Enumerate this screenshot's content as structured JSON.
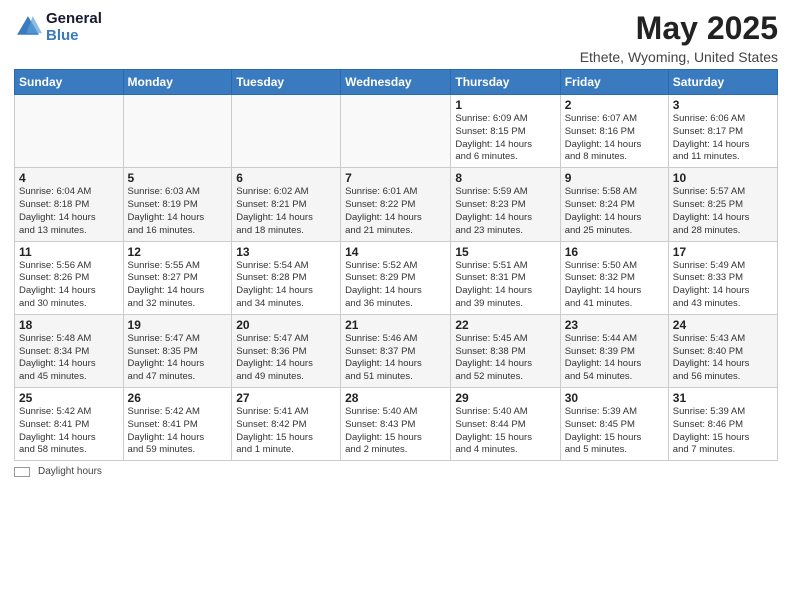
{
  "logo": {
    "line1": "General",
    "line2": "Blue"
  },
  "title": "May 2025",
  "location": "Ethete, Wyoming, United States",
  "days_of_week": [
    "Sunday",
    "Monday",
    "Tuesday",
    "Wednesday",
    "Thursday",
    "Friday",
    "Saturday"
  ],
  "footer_label": "Daylight hours",
  "weeks": [
    [
      {
        "num": "",
        "info": ""
      },
      {
        "num": "",
        "info": ""
      },
      {
        "num": "",
        "info": ""
      },
      {
        "num": "",
        "info": ""
      },
      {
        "num": "1",
        "info": "Sunrise: 6:09 AM\nSunset: 8:15 PM\nDaylight: 14 hours\nand 6 minutes."
      },
      {
        "num": "2",
        "info": "Sunrise: 6:07 AM\nSunset: 8:16 PM\nDaylight: 14 hours\nand 8 minutes."
      },
      {
        "num": "3",
        "info": "Sunrise: 6:06 AM\nSunset: 8:17 PM\nDaylight: 14 hours\nand 11 minutes."
      }
    ],
    [
      {
        "num": "4",
        "info": "Sunrise: 6:04 AM\nSunset: 8:18 PM\nDaylight: 14 hours\nand 13 minutes."
      },
      {
        "num": "5",
        "info": "Sunrise: 6:03 AM\nSunset: 8:19 PM\nDaylight: 14 hours\nand 16 minutes."
      },
      {
        "num": "6",
        "info": "Sunrise: 6:02 AM\nSunset: 8:21 PM\nDaylight: 14 hours\nand 18 minutes."
      },
      {
        "num": "7",
        "info": "Sunrise: 6:01 AM\nSunset: 8:22 PM\nDaylight: 14 hours\nand 21 minutes."
      },
      {
        "num": "8",
        "info": "Sunrise: 5:59 AM\nSunset: 8:23 PM\nDaylight: 14 hours\nand 23 minutes."
      },
      {
        "num": "9",
        "info": "Sunrise: 5:58 AM\nSunset: 8:24 PM\nDaylight: 14 hours\nand 25 minutes."
      },
      {
        "num": "10",
        "info": "Sunrise: 5:57 AM\nSunset: 8:25 PM\nDaylight: 14 hours\nand 28 minutes."
      }
    ],
    [
      {
        "num": "11",
        "info": "Sunrise: 5:56 AM\nSunset: 8:26 PM\nDaylight: 14 hours\nand 30 minutes."
      },
      {
        "num": "12",
        "info": "Sunrise: 5:55 AM\nSunset: 8:27 PM\nDaylight: 14 hours\nand 32 minutes."
      },
      {
        "num": "13",
        "info": "Sunrise: 5:54 AM\nSunset: 8:28 PM\nDaylight: 14 hours\nand 34 minutes."
      },
      {
        "num": "14",
        "info": "Sunrise: 5:52 AM\nSunset: 8:29 PM\nDaylight: 14 hours\nand 36 minutes."
      },
      {
        "num": "15",
        "info": "Sunrise: 5:51 AM\nSunset: 8:31 PM\nDaylight: 14 hours\nand 39 minutes."
      },
      {
        "num": "16",
        "info": "Sunrise: 5:50 AM\nSunset: 8:32 PM\nDaylight: 14 hours\nand 41 minutes."
      },
      {
        "num": "17",
        "info": "Sunrise: 5:49 AM\nSunset: 8:33 PM\nDaylight: 14 hours\nand 43 minutes."
      }
    ],
    [
      {
        "num": "18",
        "info": "Sunrise: 5:48 AM\nSunset: 8:34 PM\nDaylight: 14 hours\nand 45 minutes."
      },
      {
        "num": "19",
        "info": "Sunrise: 5:47 AM\nSunset: 8:35 PM\nDaylight: 14 hours\nand 47 minutes."
      },
      {
        "num": "20",
        "info": "Sunrise: 5:47 AM\nSunset: 8:36 PM\nDaylight: 14 hours\nand 49 minutes."
      },
      {
        "num": "21",
        "info": "Sunrise: 5:46 AM\nSunset: 8:37 PM\nDaylight: 14 hours\nand 51 minutes."
      },
      {
        "num": "22",
        "info": "Sunrise: 5:45 AM\nSunset: 8:38 PM\nDaylight: 14 hours\nand 52 minutes."
      },
      {
        "num": "23",
        "info": "Sunrise: 5:44 AM\nSunset: 8:39 PM\nDaylight: 14 hours\nand 54 minutes."
      },
      {
        "num": "24",
        "info": "Sunrise: 5:43 AM\nSunset: 8:40 PM\nDaylight: 14 hours\nand 56 minutes."
      }
    ],
    [
      {
        "num": "25",
        "info": "Sunrise: 5:42 AM\nSunset: 8:41 PM\nDaylight: 14 hours\nand 58 minutes."
      },
      {
        "num": "26",
        "info": "Sunrise: 5:42 AM\nSunset: 8:41 PM\nDaylight: 14 hours\nand 59 minutes."
      },
      {
        "num": "27",
        "info": "Sunrise: 5:41 AM\nSunset: 8:42 PM\nDaylight: 15 hours\nand 1 minute."
      },
      {
        "num": "28",
        "info": "Sunrise: 5:40 AM\nSunset: 8:43 PM\nDaylight: 15 hours\nand 2 minutes."
      },
      {
        "num": "29",
        "info": "Sunrise: 5:40 AM\nSunset: 8:44 PM\nDaylight: 15 hours\nand 4 minutes."
      },
      {
        "num": "30",
        "info": "Sunrise: 5:39 AM\nSunset: 8:45 PM\nDaylight: 15 hours\nand 5 minutes."
      },
      {
        "num": "31",
        "info": "Sunrise: 5:39 AM\nSunset: 8:46 PM\nDaylight: 15 hours\nand 7 minutes."
      }
    ]
  ]
}
